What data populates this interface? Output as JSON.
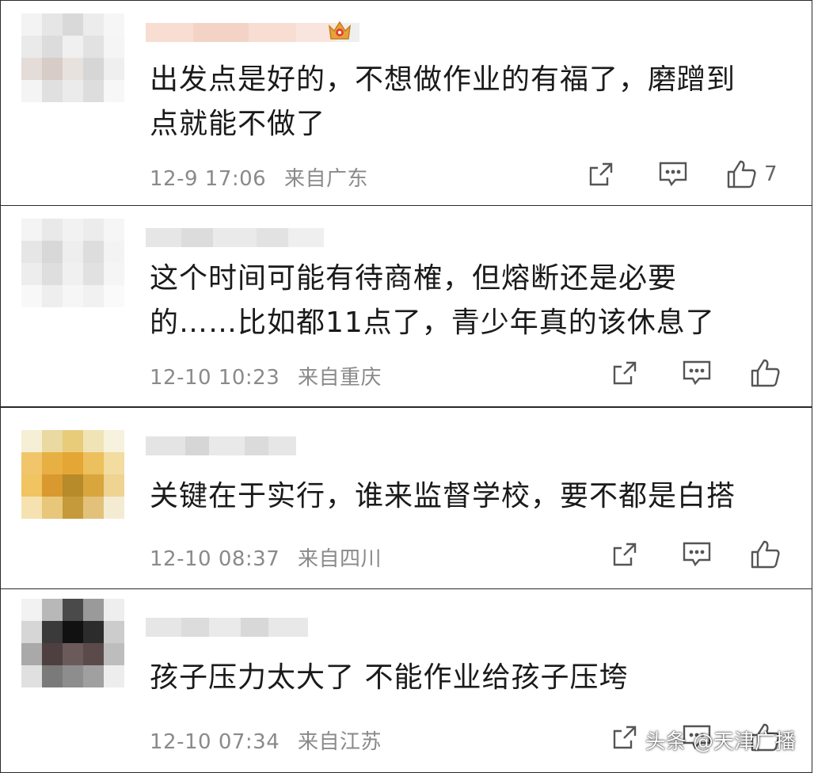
{
  "comments": [
    {
      "text": "出发点是好的，不想做作业的有福了，磨蹭到点就能不做了",
      "line1": "出发点是好的，不想做作业的有福了，磨蹭到",
      "line2": "点就能不做了",
      "date": "12-9 17:06",
      "location": "来自广东",
      "likes": "7",
      "has_crown_badge": true
    },
    {
      "line1": "这个时间可能有待商榷，但熔断还是必要",
      "line2": "的……比如都11点了，青少年真的该休息了",
      "date": "12-10 10:23",
      "location": "来自重庆",
      "likes": ""
    },
    {
      "line1": "关键在于实行，谁来监督学校，要不都是白搭",
      "date": "12-10 08:37",
      "location": "来自四川",
      "likes": ""
    },
    {
      "line1": "孩子压力太大了 不能作业给孩子压垮",
      "date": "12-10 07:34",
      "location": "来自江苏",
      "likes": ""
    }
  ],
  "icons": {
    "share": "share-icon",
    "reply": "comment-icon",
    "like": "thumbs-up-icon",
    "badge": "crown-badge-icon"
  },
  "watermark": "头条 @天津广播",
  "colors": {
    "text": "#1a1a1a",
    "meta": "#8a8a8a",
    "border": "#2a2a2a",
    "badge": "#e8a23a"
  }
}
